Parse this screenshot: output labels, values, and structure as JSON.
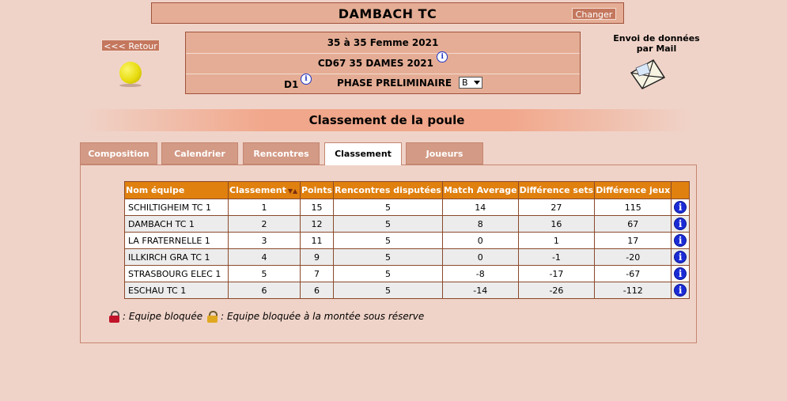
{
  "header": {
    "club_name": "DAMBACH TC",
    "change_label": "Changer",
    "back_label": "<<< Retour"
  },
  "competition": {
    "line1": "35  à 35  Femme  2021",
    "line2": "CD67 35 DAMES 2021",
    "division": "D1",
    "phase": "PHASE PRELIMINAIRE",
    "group": "B"
  },
  "mail": {
    "label_line1": "Envoi de données",
    "label_line2": "par Mail"
  },
  "section_title": "Classement de la poule",
  "tabs": [
    {
      "label": "Composition"
    },
    {
      "label": "Calendrier"
    },
    {
      "label": "Rencontres"
    },
    {
      "label": "Classement",
      "active": true
    },
    {
      "label": "Joueurs"
    }
  ],
  "table": {
    "headers": [
      "Nom équipe",
      "Classement",
      "Points",
      "Rencontres disputées",
      "Match Average",
      "Différence sets",
      "Différence jeux"
    ],
    "rows": [
      [
        "SCHILTIGHEIM TC 1",
        "1",
        "15",
        "5",
        "14",
        "27",
        "115"
      ],
      [
        "DAMBACH TC 1",
        "2",
        "12",
        "5",
        "8",
        "16",
        "67"
      ],
      [
        "LA FRATERNELLE 1",
        "3",
        "11",
        "5",
        "0",
        "1",
        "17"
      ],
      [
        "ILLKIRCH GRA TC 1",
        "4",
        "9",
        "5",
        "0",
        "-1",
        "-20"
      ],
      [
        "STRASBOURG ELEC 1",
        "5",
        "7",
        "5",
        "-8",
        "-17",
        "-67"
      ],
      [
        "ESCHAU TC 1",
        "6",
        "6",
        "5",
        "-14",
        "-26",
        "-112"
      ]
    ]
  },
  "legend": {
    "blocked": ": Equipe bloquée",
    "blocked_promotion": ": Equipe bloquée à la montée sous réserve"
  },
  "colors": {
    "background": "#f0d3c8",
    "header_fill": "#e5ad95",
    "table_header": "#e0800f",
    "info_blue": "#1a2bd6"
  }
}
